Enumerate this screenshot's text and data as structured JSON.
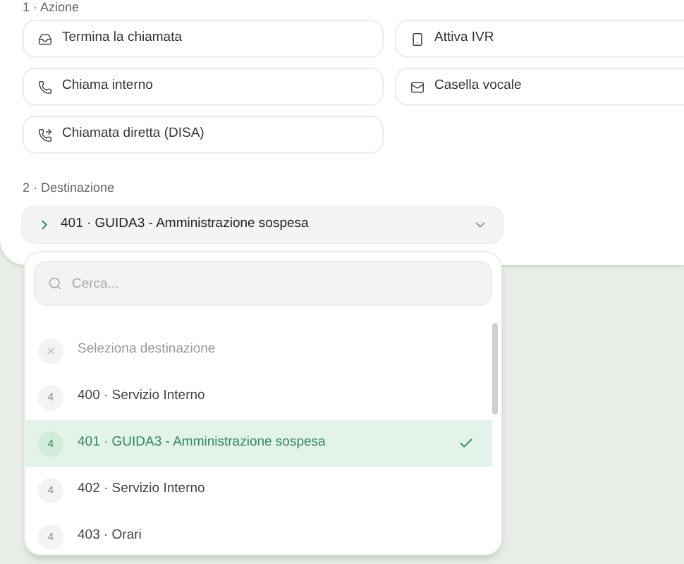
{
  "action": {
    "label": "1 · Azione",
    "options": [
      {
        "label": "Termina la chiamata",
        "kind": "hangup",
        "selected": false
      },
      {
        "label": "Attiva IVR",
        "kind": "ivr",
        "selected": false
      },
      {
        "label": "Chiama interno",
        "kind": "phone",
        "selected": false
      },
      {
        "label": "Casella vocale",
        "kind": "mail",
        "selected": false
      },
      {
        "label": "Chiamata diretta (DISA)",
        "kind": "disa",
        "selected": false
      }
    ]
  },
  "destination": {
    "label": "2 · Destinazione",
    "value": "401 · GUIDA3 - Amministrazione sospesa",
    "expanded": true,
    "search": {
      "placeholder": "Cerca..."
    },
    "items": [
      {
        "kind": "clear",
        "label": "Seleziona destinazione",
        "selected": false
      },
      {
        "kind": "option",
        "badge": "4",
        "label": "400 · Servizio Interno",
        "selected": false
      },
      {
        "kind": "option",
        "badge": "4",
        "label": "401 · GUIDA3 - Amministrazione sospesa",
        "selected": true
      },
      {
        "kind": "option",
        "badge": "4",
        "label": "402 · Servizio Interno",
        "selected": false
      },
      {
        "kind": "option",
        "badge": "4",
        "label": "403 · Orari",
        "selected": false
      }
    ]
  }
}
